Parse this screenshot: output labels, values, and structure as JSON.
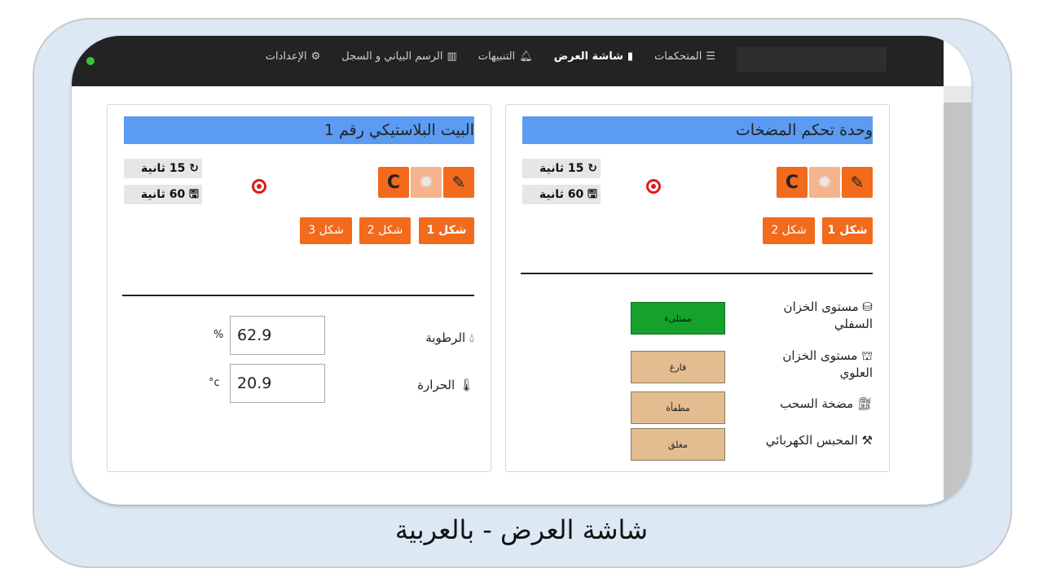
{
  "nav": {
    "items": [
      {
        "label": "المتحكمات",
        "icon": "list-icon"
      },
      {
        "label": "شاشة العرض",
        "icon": "chip-icon",
        "active": true
      },
      {
        "label": "التنبيهات",
        "icon": "bell-icon"
      },
      {
        "label": "الرسم البياني و السجل",
        "icon": "bar-chart-icon"
      },
      {
        "label": "الإعدادات",
        "icon": "gears-icon"
      }
    ]
  },
  "panels": {
    "valves": {
      "title": "وحدة تحكم المضخات",
      "timer_refresh": "15 ثانية",
      "timer_save": "60 ثانية",
      "shapes": [
        "شكل 1",
        "شكل 2"
      ],
      "rows": [
        {
          "label": "مستوى الخزان السفلي",
          "status": "ممتلىء"
        },
        {
          "label": "مستوى الخزان العلوي",
          "status": "فارغ"
        },
        {
          "label": "مضخة السحب",
          "status": "مطفأة"
        },
        {
          "label": "المحبس الكهربائي",
          "status": "مغلق"
        }
      ]
    },
    "greenhouse": {
      "title": "البيت البلاستيكي رقم 1",
      "timer_refresh": "15 ثانية",
      "timer_save": "60 ثانية",
      "shapes": [
        "شكل 1",
        "شكل 2",
        "شكل 3"
      ],
      "rows": [
        {
          "label": "الرطوبة",
          "value": "62.9",
          "unit": "%"
        },
        {
          "label": "الحرارة",
          "value": "20.9",
          "unit": "c°"
        }
      ]
    }
  },
  "caption": "شاشة العرض - بالعربية",
  "colors": {
    "navbar": "#232323",
    "title_bar": "#5b9bf2",
    "accent": "#f26a1b",
    "status_full": "#16a12d",
    "status_off": "#e3bd8f",
    "frame": "#dce9f5"
  }
}
